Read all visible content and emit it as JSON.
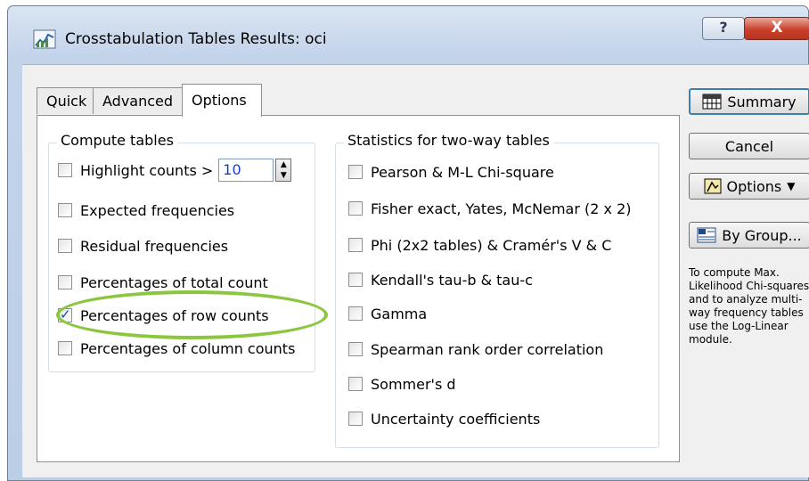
{
  "window": {
    "title": "Crosstabulation Tables Results: oci",
    "help_label": "?",
    "close_label": "X"
  },
  "tabs": [
    {
      "label": "Quick",
      "active": false
    },
    {
      "label": "Advanced",
      "active": false
    },
    {
      "label": "Options",
      "active": true
    }
  ],
  "compute_tables": {
    "title": "Compute tables",
    "highlight": {
      "label": "Highlight counts >",
      "value": "10",
      "checked": false
    },
    "items": [
      {
        "label": "Expected frequencies",
        "checked": false
      },
      {
        "label": "Residual frequencies",
        "checked": false
      },
      {
        "label": "Percentages of total count",
        "checked": false
      },
      {
        "label": "Percentages of row counts",
        "checked": true
      },
      {
        "label": "Percentages of column counts",
        "checked": false
      }
    ]
  },
  "stats": {
    "title": "Statistics for two-way tables",
    "items": [
      {
        "label": "Pearson & M-L Chi-square",
        "checked": false
      },
      {
        "label": "Fisher exact, Yates, McNemar (2 x 2)",
        "checked": false
      },
      {
        "label": "Phi (2x2 tables) & Cramér's V &  C",
        "checked": false
      },
      {
        "label": "Kendall's tau-b & tau-c",
        "checked": false
      },
      {
        "label": "Gamma",
        "checked": false
      },
      {
        "label": "Spearman rank order correlation",
        "checked": false
      },
      {
        "label": "Sommer's d",
        "checked": false
      },
      {
        "label": "Uncertainty coefficients",
        "checked": false
      }
    ]
  },
  "buttons": {
    "summary": "Summary",
    "cancel": "Cancel",
    "options": "Options",
    "by_group": "By Group..."
  },
  "note": "To compute Max. Likelihood Chi-squares and to analyze multi-way frequency tables use the Log-Linear module.",
  "colors": {
    "highlight_ring": "#8cc63f",
    "spin_value": "#1a3bd1"
  }
}
